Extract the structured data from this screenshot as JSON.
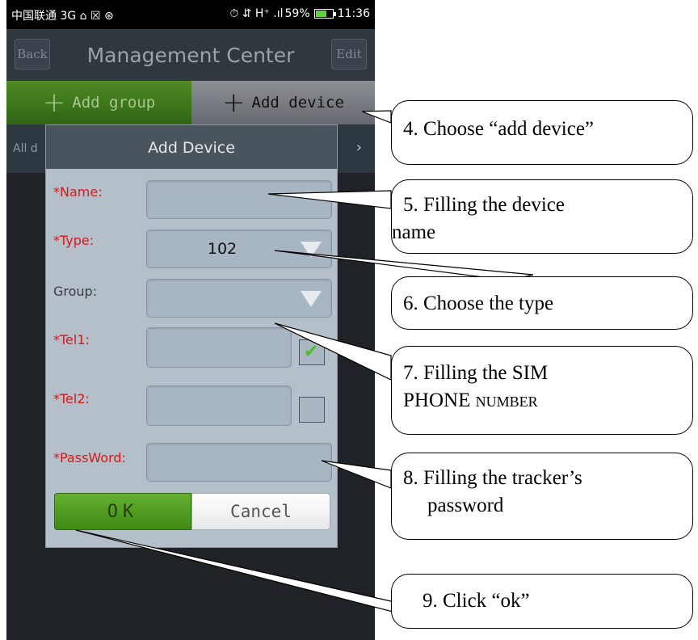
{
  "status_bar": {
    "left": "中国联通 3G ⌂ ☒ ⊛",
    "right_signal": "⏱ ⇵ H⁺ .ıl",
    "battery": "59%",
    "time": "11:36"
  },
  "header": {
    "back_label": "Back",
    "title": "Management Center",
    "edit_label": "Edit"
  },
  "tabs": {
    "add_group": "Add group",
    "add_device": "Add device"
  },
  "list": {
    "first_row_label": "All d"
  },
  "dialog": {
    "title": "Add Device",
    "name_label": "*Name:",
    "type_label": "*Type:",
    "type_value": "102",
    "group_label": "Group:",
    "tel1_label": "*Tel1:",
    "tel1_checked": true,
    "tel2_label": "*Tel2:",
    "tel2_checked": false,
    "password_label": "*PassWord:",
    "ok_label": "OK",
    "cancel_label": "Cancel"
  },
  "callouts": {
    "c4": "4. Choose “add device”",
    "c5_line1": "5. Filling the device",
    "c5_line2": "name",
    "c6": "6. Choose the type",
    "c7_line1": "7. Filling the SIM",
    "c7_line2_a": "PHONE ",
    "c7_line2_b": "NUMBER",
    "c8_line1": "8. Filling the tracker’s",
    "c8_line2": "password",
    "c9": "9. Click “ok”"
  }
}
